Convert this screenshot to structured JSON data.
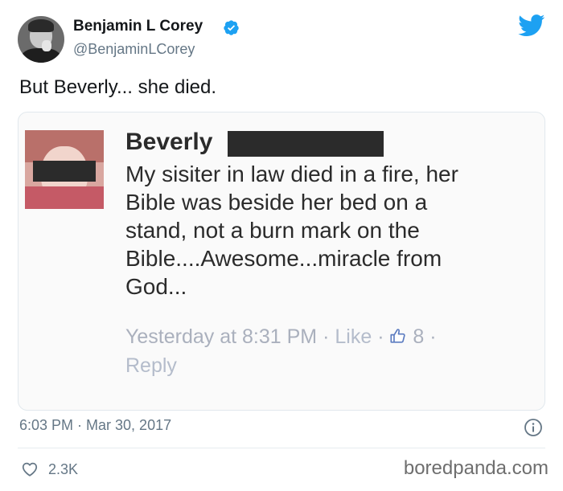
{
  "tweet": {
    "author": {
      "display_name": "Benjamin L Corey",
      "handle": "@BenjaminLCorey",
      "verified": true
    },
    "text": "But Beverly... she died.",
    "timestamp": "6:03 PM · Mar 30, 2017",
    "like_count": "2.3K",
    "icons": {
      "verified": "verified-badge-icon",
      "brand": "twitter-bird-icon",
      "info": "info-icon",
      "like": "heart-icon"
    },
    "colors": {
      "twitter_blue": "#1da1f2",
      "secondary_text": "#657786"
    }
  },
  "embedded_post": {
    "author_name": "Beverly",
    "lines": [
      "My sisiter in law died in a fire, her",
      "Bible was beside her bed on a",
      "stand, not a burn mark on the",
      "Bible....Awesome...miracle from",
      "God..."
    ],
    "meta": {
      "time": "Yesterday at 8:31 PM",
      "sep": "·",
      "like_label": "Like",
      "like_count": "8",
      "reply_label": "Reply"
    }
  },
  "watermark": "boredpanda.com"
}
